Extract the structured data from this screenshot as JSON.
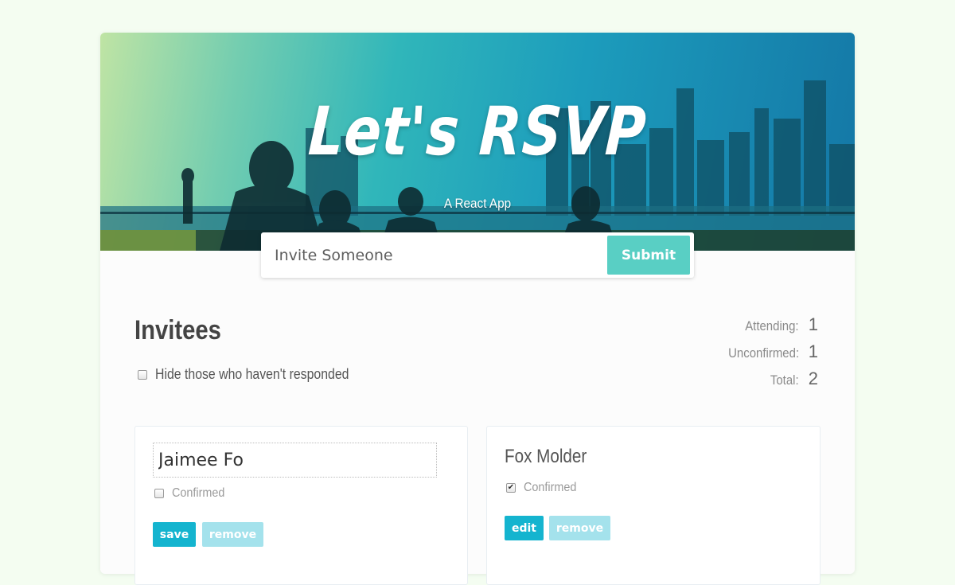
{
  "header": {
    "title": "Let's RSVP",
    "subtitle": "A React App"
  },
  "invite_form": {
    "placeholder": "Invite Someone",
    "submit_label": "Submit"
  },
  "main": {
    "section_title": "Invitees",
    "filter": {
      "label": "Hide those who haven't responded",
      "checked": false
    },
    "counter": [
      {
        "label": "Attending:",
        "value": "1"
      },
      {
        "label": "Unconfirmed:",
        "value": "1"
      },
      {
        "label": "Total:",
        "value": "2"
      }
    ]
  },
  "guests": [
    {
      "name": "Jaimee Fo",
      "editing": true,
      "confirmed_label": "Confirmed",
      "confirmed": false,
      "primary_button": "save",
      "secondary_button": "remove"
    },
    {
      "name": "Fox Molder",
      "editing": false,
      "confirmed_label": "Confirmed",
      "confirmed": true,
      "primary_button": "edit",
      "secondary_button": "remove"
    }
  ],
  "colors": {
    "accent": "#59cfc4",
    "button_primary": "#14b4cf",
    "button_light": "#a4e2ec",
    "page_background": "#f4fdf1"
  }
}
